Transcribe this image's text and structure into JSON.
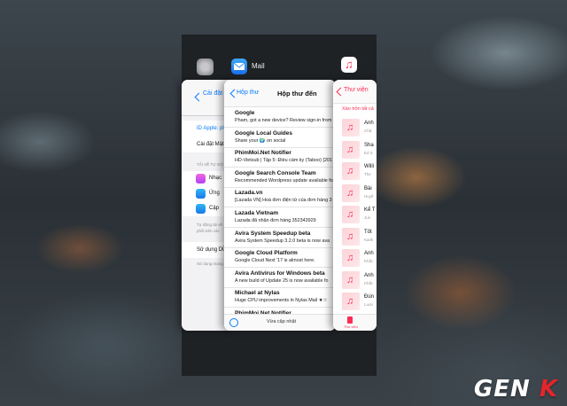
{
  "settings_card": {
    "back_label": "Cài đặt",
    "apple_id": "ID Apple: pl",
    "password_row": "Cài đặt Mật",
    "section_header": "TẢI VỀ TỰ ĐỘ",
    "rows": [
      "Nhạc",
      "Ứng",
      "Cập"
    ],
    "footer_text": [
      "Tự động tải về",
      "phối trên các"
    ],
    "data_row": "Sử dụng DỮ",
    "data_footer": "Sử dụng mạng"
  },
  "mail_card": {
    "app_name": "Mail",
    "back_label": "Hộp thư",
    "title": "Hộp thư đến",
    "messages": [
      {
        "sender": "Google",
        "snippet": "Pham, got a new device? Review sign-in from"
      },
      {
        "sender": "Google Local Guides",
        "snippet": "Share your 🌍 on social"
      },
      {
        "sender": "PhimMoi.Net Notifier",
        "snippet": "HD-Vietsub | Tập 5: Điều cấm ky (Taboo) [201"
      },
      {
        "sender": "Google Search Console Team",
        "snippet": "Recommended Wordpress update available for"
      },
      {
        "sender": "Lazada.vn",
        "snippet": "[Lazada VN] Hoá đơn điện tử của đơn hàng 3"
      },
      {
        "sender": "Lazada Vietnam",
        "snippet": "Lazada đã nhận đơn hàng 352343929"
      },
      {
        "sender": "Avira System Speedup beta",
        "snippet": "Avira System Speedup 3.2.0 beta is now ava"
      },
      {
        "sender": "Google Cloud Platform",
        "snippet": "Google Cloud Next '17 is almost here."
      },
      {
        "sender": "Avira Antivirus for Windows beta",
        "snippet": "A new build of Update 25 is now available fo"
      },
      {
        "sender": "Michael at Nylas",
        "snippet": "Huge CPU improvements in Nylas Mail ★☆"
      },
      {
        "sender": "PhimMoi.Net Notifier",
        "snippet": "HD-Vietsub | Tập 4: Điều cấm ky (Taboo) [201"
      }
    ],
    "status_text": "Vừa cập nhật"
  },
  "music_card": {
    "back_label": "Thư viện",
    "shuffle_label": "Xáo trộn tất cả",
    "songs": [
      {
        "title": "Anh",
        "artist": "Chă"
      },
      {
        "title": "Sha",
        "artist": "Ed S"
      },
      {
        "title": "Willi",
        "artist": "The"
      },
      {
        "title": "Bài",
        "artist": "Huyề"
      },
      {
        "title": "Kể T",
        "artist": "Jun"
      },
      {
        "title": "Tốt",
        "artist": "Karik"
      },
      {
        "title": "Anh",
        "artist": "Khắc"
      },
      {
        "title": "Anh",
        "artist": "Khắc"
      },
      {
        "title": "Đún",
        "artist": "Luon"
      }
    ],
    "tab_label": "Thư viện"
  },
  "watermark": "GENK",
  "colors": {
    "ios_blue": "#0a7cff",
    "music_pink": "#ff2d55",
    "logo_red": "#e3262d"
  }
}
